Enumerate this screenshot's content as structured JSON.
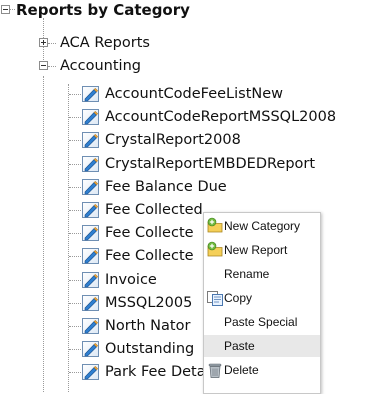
{
  "tree": {
    "root_label": "Reports by Category",
    "categories": [
      {
        "label": "ACA Reports"
      },
      {
        "label": "Accounting"
      }
    ],
    "reports": [
      {
        "label": "AccountCodeFeeListNew"
      },
      {
        "label": "AccountCodeReportMSSQL2008"
      },
      {
        "label": "CrystalReport2008"
      },
      {
        "label": "CrystalReportEMBDEDReport"
      },
      {
        "label": "Fee Balance Due"
      },
      {
        "label": "Fee Collected"
      },
      {
        "label": "Fee Collecte"
      },
      {
        "label": "Fee Collecte"
      },
      {
        "label": "Invoice"
      },
      {
        "label": "MSSQL2005"
      },
      {
        "label": "North Nator"
      },
      {
        "label": "Outstanding"
      },
      {
        "label": "Park Fee Detail"
      }
    ]
  },
  "context_menu": {
    "items": [
      {
        "label": "New Category",
        "icon": "new-category-icon"
      },
      {
        "label": "New Report",
        "icon": "new-report-icon"
      },
      {
        "label": "Rename"
      },
      {
        "label": "Copy",
        "icon": "copy-icon"
      },
      {
        "label": "Paste Special"
      },
      {
        "label": "Paste",
        "highlighted": true
      },
      {
        "label": "Delete",
        "icon": "trash-icon"
      }
    ]
  }
}
